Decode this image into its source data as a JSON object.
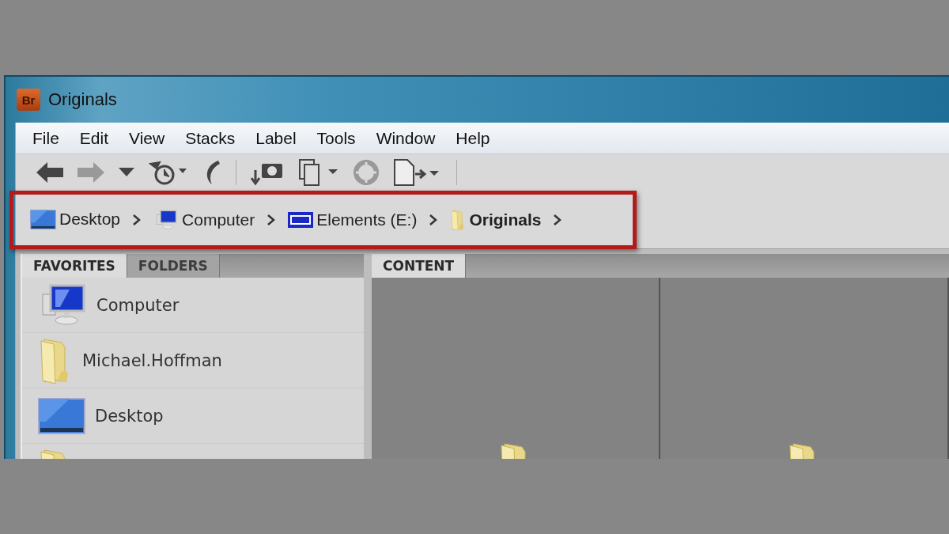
{
  "window": {
    "icon_text": "Br",
    "title": "Originals"
  },
  "menu": [
    "File",
    "Edit",
    "View",
    "Stacks",
    "Label",
    "Tools",
    "Window",
    "Help"
  ],
  "path_bar": {
    "highlighted": true,
    "crumbs": [
      {
        "label": "Desktop",
        "kind": "desktop",
        "selected": false
      },
      {
        "label": "Computer",
        "kind": "computer",
        "selected": false
      },
      {
        "label": "Elements (E:)",
        "kind": "drive",
        "selected": false
      },
      {
        "label": "Originals",
        "kind": "folder",
        "selected": true
      }
    ]
  },
  "left_panel": {
    "tabs": [
      {
        "label": "FAVORITES",
        "selected": true
      },
      {
        "label": "FOLDERS",
        "selected": false
      }
    ],
    "items": [
      {
        "label": "Computer",
        "kind": "computer"
      },
      {
        "label": "Michael.Hoffman",
        "kind": "folder"
      },
      {
        "label": "Desktop",
        "kind": "desktop"
      },
      {
        "kind": "folder"
      }
    ]
  },
  "content_panel": {
    "tabs": [
      {
        "label": "CONTENT",
        "selected": true
      }
    ],
    "thumbnails": [
      {
        "kind": "folder"
      },
      {
        "kind": "folder"
      }
    ]
  }
}
